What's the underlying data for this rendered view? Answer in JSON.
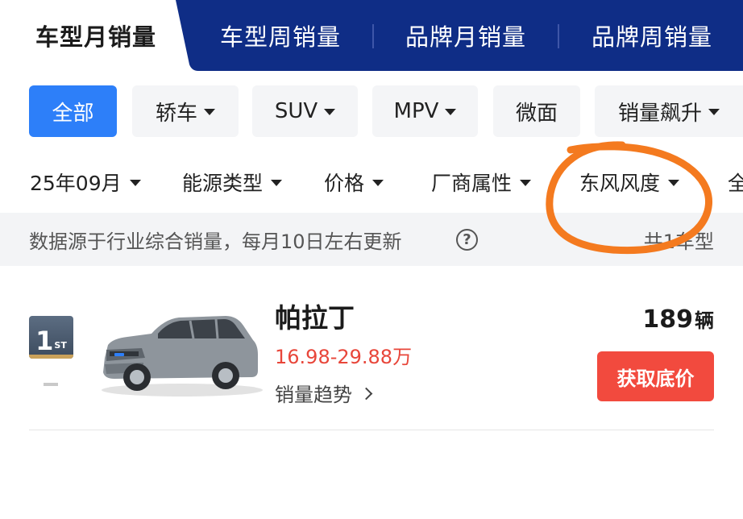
{
  "tabs": [
    {
      "label": "车型月销量",
      "active": true
    },
    {
      "label": "车型周销量",
      "active": false
    },
    {
      "label": "品牌月销量",
      "active": false
    },
    {
      "label": "品牌周销量",
      "active": false
    }
  ],
  "categories": [
    {
      "label": "全部",
      "active": true,
      "dropdown": false
    },
    {
      "label": "轿车",
      "active": false,
      "dropdown": true
    },
    {
      "label": "SUV",
      "active": false,
      "dropdown": true
    },
    {
      "label": "MPV",
      "active": false,
      "dropdown": true
    },
    {
      "label": "微面",
      "active": false,
      "dropdown": false
    },
    {
      "label": "销量飙升",
      "active": false,
      "dropdown": true
    }
  ],
  "filters": [
    {
      "label": "25年09月"
    },
    {
      "label": "能源类型"
    },
    {
      "label": "价格"
    },
    {
      "label": "厂商属性"
    },
    {
      "label": "东风风度"
    },
    {
      "label": "全"
    }
  ],
  "info": {
    "source_text": "数据源于行业综合销量，每月10日左右更新",
    "count_text": "共1车型"
  },
  "rankings": [
    {
      "rank": "1",
      "rank_suffix": "ST",
      "name": "帕拉丁",
      "price_range": "16.98-29.88万",
      "sales_value": "189",
      "sales_unit": "辆",
      "trend_label": "销量趋势",
      "button_label": "获取底价"
    }
  ],
  "colors": {
    "tab_blue": "#0f2d86",
    "accent_blue": "#2d7ff9",
    "price_red": "#e8463a",
    "button_red": "#f24a3e",
    "annotation_orange": "#f47a1f",
    "badge_gold": "#c9a15a"
  }
}
